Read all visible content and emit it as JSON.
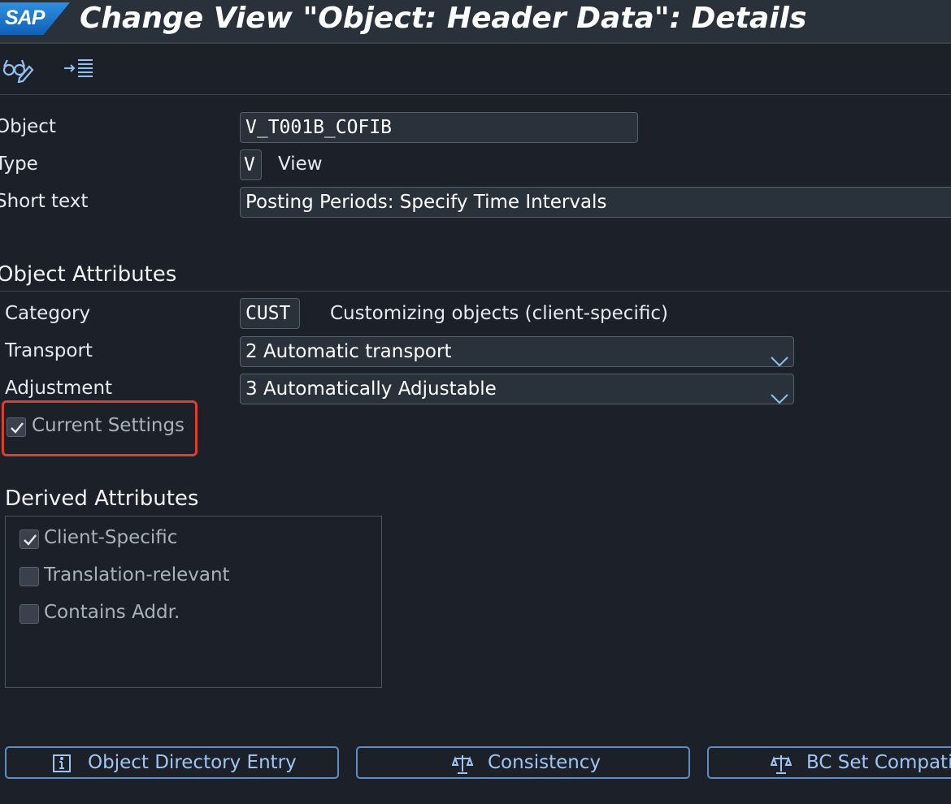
{
  "header": {
    "logo_text": "SAP",
    "title": "Change View \"Object: Header Data\": Details"
  },
  "toolbar": {
    "icons": [
      "display-change-icon",
      "expand-list-icon"
    ]
  },
  "object": {
    "object_label": "Object",
    "object_value": "V_T001B_COFIB",
    "type_label": "Type",
    "type_value": "V",
    "type_text": "View",
    "short_text_label": "Short text",
    "short_text_value": "Posting Periods: Specify Time Intervals"
  },
  "object_attributes": {
    "title": "Object Attributes",
    "category_label": "Category",
    "category_value": "CUST",
    "category_text": "Customizing objects (client-specific)",
    "transport_label": "Transport",
    "transport_value": "2  Automatic transport",
    "adjustment_label": "Adjustment",
    "adjustment_value": "3  Automatically Adjustable",
    "current_settings_label": "Current Settings",
    "current_settings_checked": true
  },
  "derived_attributes": {
    "title": "Derived Attributes",
    "items": [
      {
        "label": "Client-Specific",
        "checked": true
      },
      {
        "label": "Translation-relevant",
        "checked": false
      },
      {
        "label": "Contains Addr.",
        "checked": false
      }
    ]
  },
  "buttons": {
    "object_directory": "Object Directory Entry",
    "consistency": "Consistency",
    "bc_set": "BC Set Compatibility"
  },
  "colors": {
    "background": "#1c2028",
    "field": "#29313a",
    "accent": "#5d8ec7",
    "highlight": "#d9412f"
  }
}
